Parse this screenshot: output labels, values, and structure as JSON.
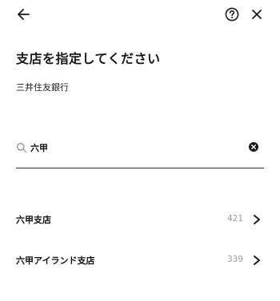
{
  "header": {
    "back_icon": "arrow-left-icon",
    "help_icon": "question-circle-icon",
    "close_icon": "close-icon"
  },
  "page": {
    "title": "支店を指定してください",
    "bank_name": "三井住友銀行"
  },
  "search": {
    "value": "六甲",
    "icon": "search-icon",
    "clear_icon": "clear-circle-icon"
  },
  "results": [
    {
      "name": "六甲支店",
      "code": "421"
    },
    {
      "name": "六甲アイランド支店",
      "code": "339"
    }
  ],
  "colors": {
    "text": "#1a1a1a",
    "muted": "#9a9a9a",
    "background": "#ffffff"
  }
}
